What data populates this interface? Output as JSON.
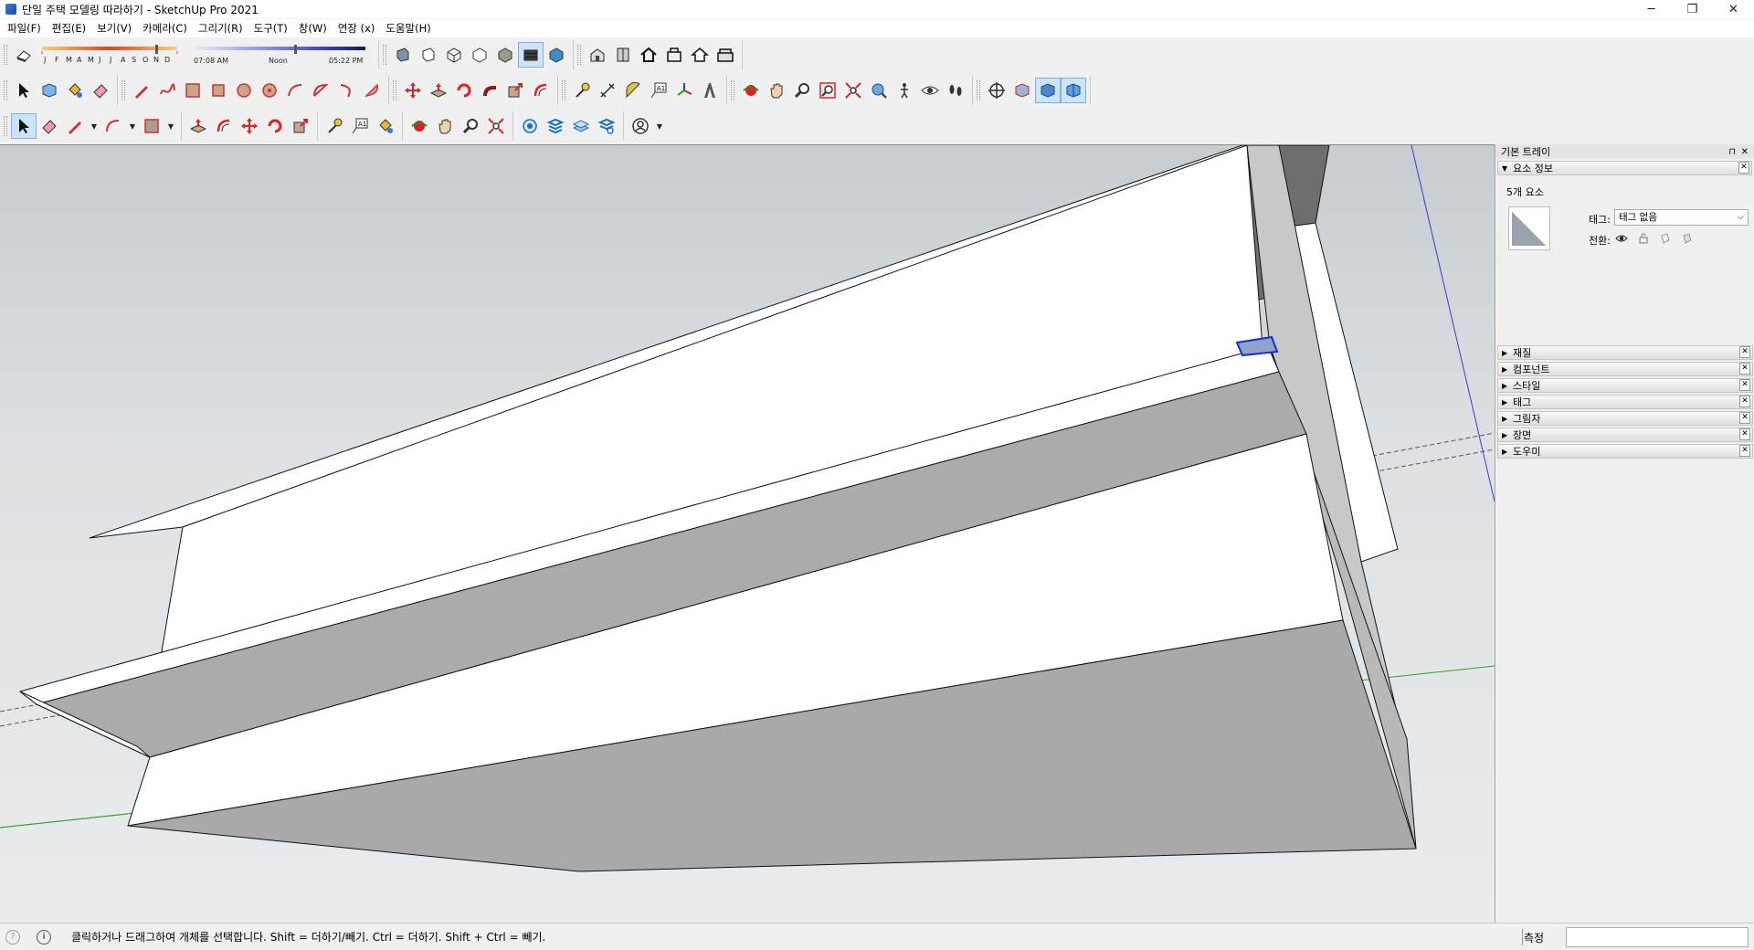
{
  "window": {
    "title": "단일 주택 모델링 따라하기 - SketchUp Pro 2021",
    "min_glyph": "─",
    "max_glyph": "❐",
    "close_glyph": "✕"
  },
  "menu": [
    "파일(F)",
    "편집(E)",
    "보기(V)",
    "카메라(C)",
    "그리기(R)",
    "도구(T)",
    "창(W)",
    "연장 (x)",
    "도움말(H)"
  ],
  "shadow_bar": {
    "months": [
      "J",
      "F",
      "M",
      "A",
      "M",
      "J",
      "J",
      "A",
      "S",
      "O",
      "N",
      "D"
    ],
    "time_start": "07:08 AM",
    "time_mid": "Noon",
    "time_end": "05:22 PM"
  },
  "toolbar1": {
    "icons": [
      "eraser-icon",
      "xray-face-icon",
      "back-edges-icon",
      "wireframe-icon",
      "hidden-line-icon",
      "shaded-icon",
      "shaded-textures-icon",
      "monochrome-icon",
      "warehouse-icon",
      "components-3d-icon",
      "home-icon",
      "extension-warehouse-icon",
      "house-outline-icon",
      "share-model-icon"
    ]
  },
  "toolbar2": {
    "icons": [
      "select-icon",
      "component-icon",
      "paint-bucket-icon",
      "eraser-icon",
      "pencil-line-icon",
      "freehand-icon",
      "rectangle-icon",
      "rotated-rectangle-icon",
      "circle-icon",
      "polygon-icon",
      "arc-icon",
      "two-point-arc-icon",
      "three-point-arc-icon",
      "pie-icon",
      "move-icon",
      "push-pull-icon",
      "rotate-icon",
      "follow-me-icon",
      "scale-icon",
      "offset-icon",
      "tape-measure-icon",
      "dimension-icon",
      "protractor-icon",
      "text-icon",
      "axes-icon",
      "3d-text-icon",
      "orbit-icon",
      "pan-icon",
      "zoom-icon",
      "zoom-window-icon",
      "zoom-extents-icon",
      "position-camera-icon",
      "walk-icon",
      "look-around-icon",
      "footprint-icon",
      "section-plane-icon",
      "display-section-icon",
      "section-cuts-icon",
      "section-fill-icon"
    ]
  },
  "toolbar3": {
    "icons": [
      "select-icon",
      "eraser-icon",
      "pencil-line-icon",
      "arc-icon",
      "rectangle-icon",
      "push-pull-icon",
      "offset-icon",
      "move-icon",
      "rotate-icon",
      "scale-icon",
      "tape-measure-icon",
      "text-icon",
      "paint-bucket-icon",
      "orbit-icon",
      "pan-icon",
      "zoom-icon",
      "zoom-extents-icon",
      "warehouse-icon",
      "layers-icon",
      "sandbox-icon",
      "settings-layers-icon",
      "account-icon"
    ]
  },
  "tray": {
    "title": "기본 트레이",
    "pin_glyph": "⊓",
    "close_glyph": "✕",
    "entity_panel": {
      "title": "요소 정보",
      "count_text": "5개 요소",
      "tag_label": "태그:",
      "tag_value": "태그 없음",
      "toggle_label": "전환:"
    },
    "panels": [
      "재질",
      "컴포넌트",
      "스타일",
      "태그",
      "그림자",
      "장면",
      "도우미"
    ]
  },
  "status": {
    "hint": "클릭하거나 드래그하여 개체를 선택합니다. Shift = 더하기/빼기. Ctrl = 더하기. Shift + Ctrl = 빼기.",
    "measure_label": "측정",
    "measure_value": ""
  },
  "colors": {
    "accent_select": "#cde3f7",
    "axis_green": "#2ea02e",
    "axis_blue": "#3a3ad0",
    "face_white": "#ffffff",
    "face_gray": "#a9a9a9",
    "face_dark": "#6e6e6e"
  }
}
